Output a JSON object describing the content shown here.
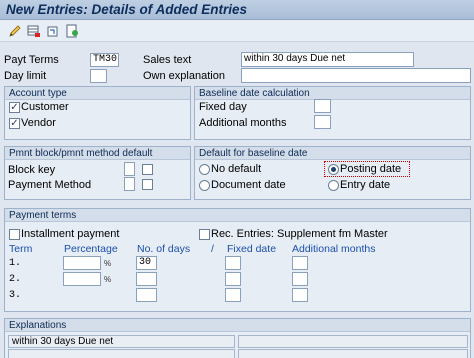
{
  "window": {
    "title": "New Entries: Details of Added Entries"
  },
  "toolbar": {
    "icons": [
      "edit-pen-icon",
      "table-delete-icon",
      "undo-icon",
      "detail-icon"
    ]
  },
  "header": {
    "payt_terms_label": "Payt Terms",
    "payt_terms_value": "TM30",
    "sales_text_label": "Sales text",
    "sales_text_value": "within 30 days Due net",
    "day_limit_label": "Day limit",
    "day_limit_value": "",
    "own_explanation_label": "Own explanation",
    "own_explanation_value": ""
  },
  "account_type": {
    "title": "Account type",
    "customer_label": "Customer",
    "customer_checked": true,
    "vendor_label": "Vendor",
    "vendor_checked": true
  },
  "baseline_calc": {
    "title": "Baseline date calculation",
    "fixed_day_label": "Fixed day",
    "fixed_day_value": "",
    "additional_months_label": "Additional months",
    "additional_months_value": ""
  },
  "pmnt_block": {
    "title": "Pmnt block/pmnt method default",
    "block_key_label": "Block key",
    "payment_method_label": "Payment Method"
  },
  "default_baseline": {
    "title": "Default for baseline date",
    "no_default_label": "No default",
    "posting_date_label": "Posting date",
    "document_date_label": "Document date",
    "entry_date_label": "Entry date",
    "selected": "posting_date"
  },
  "payment_terms": {
    "title": "Payment terms",
    "installment_label": "Installment payment",
    "rec_entries_label": "Rec. Entries: Supplement fm Master",
    "col_term": "Term",
    "col_percentage": "Percentage",
    "col_days": "No. of days",
    "col_slash": "/",
    "col_fixed": "Fixed date",
    "col_additional": "Additional months",
    "percent_unit": "%",
    "rows": [
      {
        "term": "1.",
        "percentage": "",
        "days": "30",
        "fixed": "",
        "additional": ""
      },
      {
        "term": "2.",
        "percentage": "",
        "days": "",
        "fixed": "",
        "additional": ""
      },
      {
        "term": "3.",
        "percentage": "",
        "days": "",
        "fixed": "",
        "additional": ""
      }
    ]
  },
  "explanations": {
    "title": "Explanations",
    "line1": "within 30 days Due net"
  }
}
